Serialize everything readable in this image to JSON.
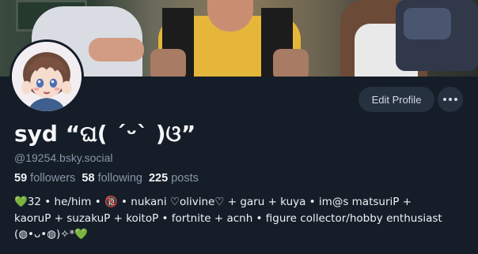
{
  "banner": {
    "alt": "header banner photo"
  },
  "profile": {
    "display_name": "syd “ଘ( ˊᵕˋ )ଓ”",
    "handle": "@19254.bsky.social",
    "followers_count": "59",
    "followers_label": "followers",
    "following_count": "58",
    "following_label": "following",
    "posts_count": "225",
    "posts_label": "posts"
  },
  "actions": {
    "edit_profile": "Edit Profile",
    "more_icon": "ellipsis-icon"
  },
  "bio": {
    "line1": "💚32  • he/him  • 🔞 • nukani ♡olivine♡ + garu + kuya • im@s matsuriP +",
    "line2": "kaoruP + suzakuP + koitoP • fortnite + acnh  • figure collector/hobby enthusiast",
    "line3": "(◍•ᴗ•◍)✧*💚"
  },
  "colors": {
    "background": "#151d28",
    "button_bg": "#263140",
    "muted_text": "#8795a8",
    "text": "#f1f3f5"
  }
}
